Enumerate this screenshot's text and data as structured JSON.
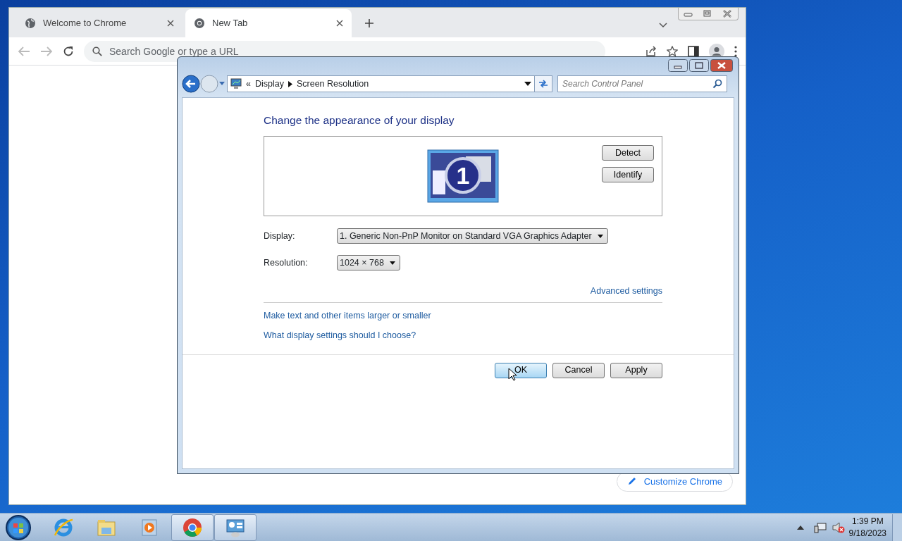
{
  "chrome": {
    "tabs": [
      {
        "title": "Welcome to Chrome",
        "selected": false
      },
      {
        "title": "New Tab",
        "selected": true
      }
    ],
    "omnibox": {
      "placeholder": "Search Google or type a URL"
    },
    "customize_button": "Customize Chrome"
  },
  "dialog": {
    "breadcrumb_overflow": "«",
    "breadcrumb": [
      "Display",
      "Screen Resolution"
    ],
    "search": {
      "placeholder": "Search Control Panel"
    },
    "heading": "Change the appearance of your display",
    "monitor_number": "1",
    "side_buttons": [
      "Detect",
      "Identify"
    ],
    "fields": [
      {
        "label": "Display:",
        "value": "1. Generic Non-PnP Monitor on Standard VGA Graphics Adapter"
      },
      {
        "label": "Resolution:",
        "value": "1024 × 768"
      }
    ],
    "advanced_link": "Advanced settings",
    "links": [
      "Make text and other items larger or smaller",
      "What display settings should I choose?"
    ],
    "buttons": [
      {
        "label": "OK",
        "default": true
      },
      {
        "label": "Cancel",
        "default": false
      },
      {
        "label": "Apply",
        "default": false
      }
    ]
  },
  "taskbar": {
    "apps": [
      {
        "kind": "ie",
        "active": false
      },
      {
        "kind": "explorer",
        "active": false
      },
      {
        "kind": "media",
        "active": false
      },
      {
        "kind": "chrome",
        "active": true
      },
      {
        "kind": "control",
        "active": true
      }
    ],
    "clock": {
      "time": "1:39 PM",
      "date": "9/18/2023"
    }
  }
}
